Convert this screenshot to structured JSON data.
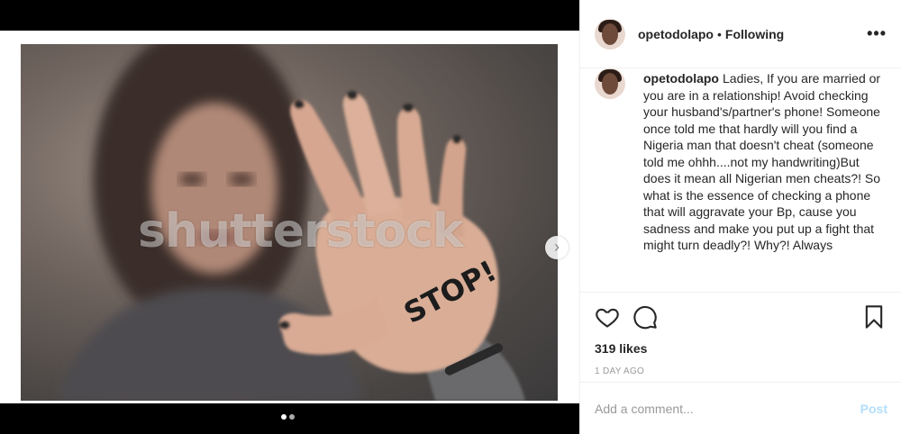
{
  "post": {
    "username": "opetodolapo",
    "follow_status": "Following",
    "separator": "•",
    "more_label": "•••"
  },
  "media": {
    "watermark": "shutterstock",
    "hand_text": "STOP!",
    "next_glyph": "›",
    "slide_count": 2,
    "active_slide": 1
  },
  "caption": {
    "username": "opetodolapo",
    "text": "Ladies, If you are married or you are in a relationship! Avoid checking your husband's/partner's phone! Someone once told me that hardly will you find a Nigeria man that doesn't cheat (someone told me ohhh....not my handwriting)But does it mean all Nigerian men cheats?! So what is the essence of checking a phone that will aggravate your Bp, cause you sadness and make you put up a fight that might turn deadly?! Why?! Always"
  },
  "actions": {
    "like_icon": "heart-icon",
    "comment_icon": "comment-bubble-icon",
    "save_icon": "bookmark-icon"
  },
  "stats": {
    "likes": "319 likes",
    "date": "1 DAY AGO"
  },
  "comment_box": {
    "placeholder": "Add a comment...",
    "post_label": "Post"
  },
  "colors": {
    "text": "#262626",
    "muted": "#999999",
    "border": "#efefef",
    "post_disabled": "#b2dffc"
  }
}
